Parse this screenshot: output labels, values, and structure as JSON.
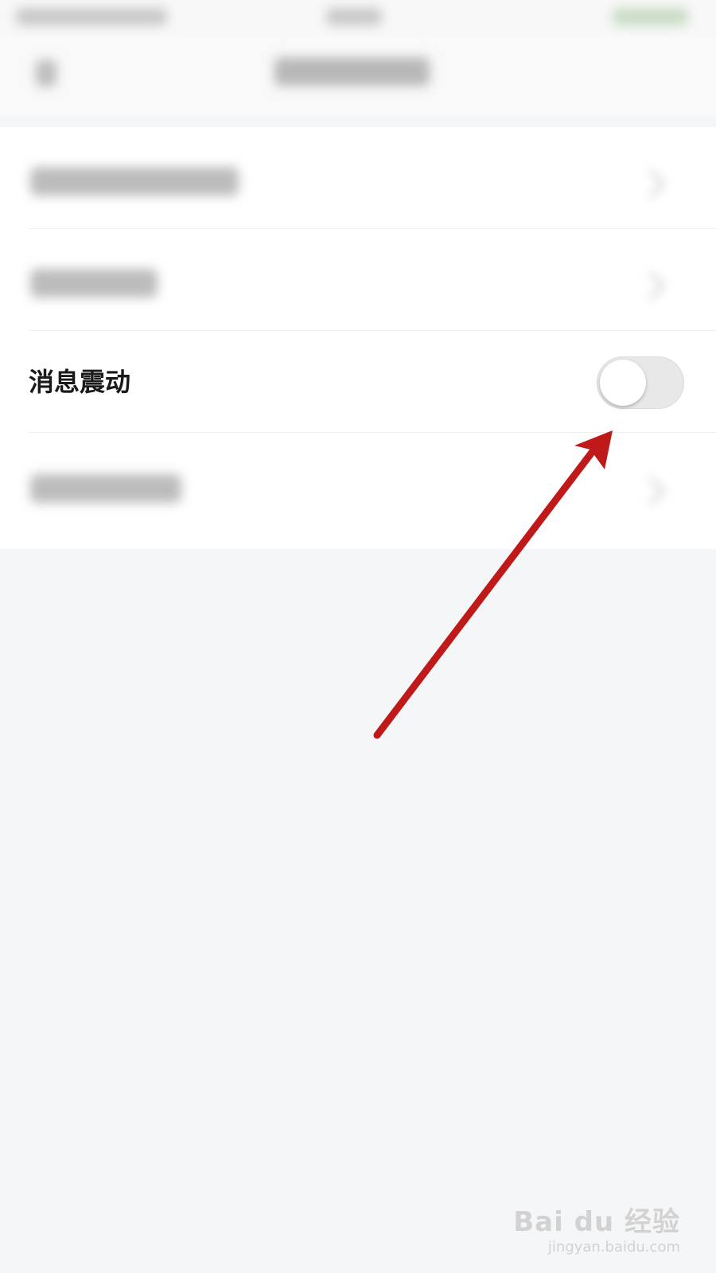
{
  "settings": {
    "items": [
      {
        "label": "消息震动",
        "toggle_on": false
      }
    ]
  },
  "colors": {
    "toggle_track_off": "#e8e8e8",
    "toggle_knob": "#ffffff",
    "annotation_arrow": "#c0191a",
    "background": "#f5f6f8"
  },
  "watermark": {
    "logo": "Bai du 经验",
    "url": "jingyan.baidu.com"
  }
}
